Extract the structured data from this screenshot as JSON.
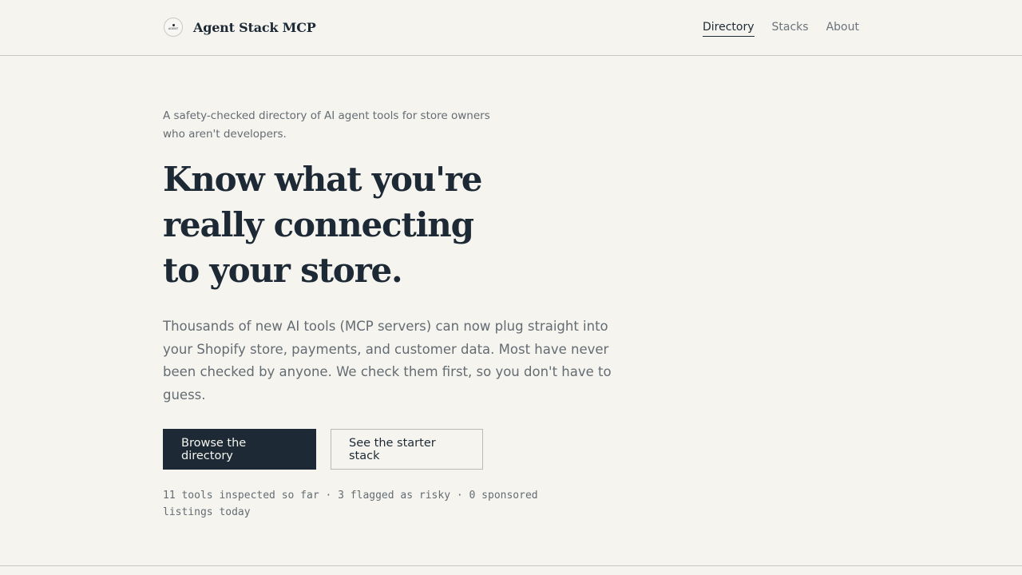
{
  "header": {
    "logo_text": "AGENT",
    "brand_name": "Agent Stack MCP",
    "nav": [
      {
        "label": "Directory",
        "active": true
      },
      {
        "label": "Stacks",
        "active": false
      },
      {
        "label": "About",
        "active": false
      }
    ]
  },
  "hero": {
    "tagline": "A safety-checked directory of AI agent tools for store owners who aren't developers.",
    "headline_lines": [
      "Know what you're",
      "really connecting",
      "to your store."
    ],
    "description": "Thousands of new AI tools (MCP servers) can now plug straight into your Shopify store, payments, and customer data. Most have never been checked by anyone. We check them first, so you don't have to guess.",
    "primary_button": "Browse the directory",
    "secondary_button": "See the starter stack",
    "stats": "11 tools inspected so far · 3 flagged as risky · 0 sponsored listings today"
  },
  "colors": {
    "background": "#f5f4ef",
    "ink": "#1d2a35",
    "muted": "#646c73",
    "border": "#c9c9c4"
  }
}
